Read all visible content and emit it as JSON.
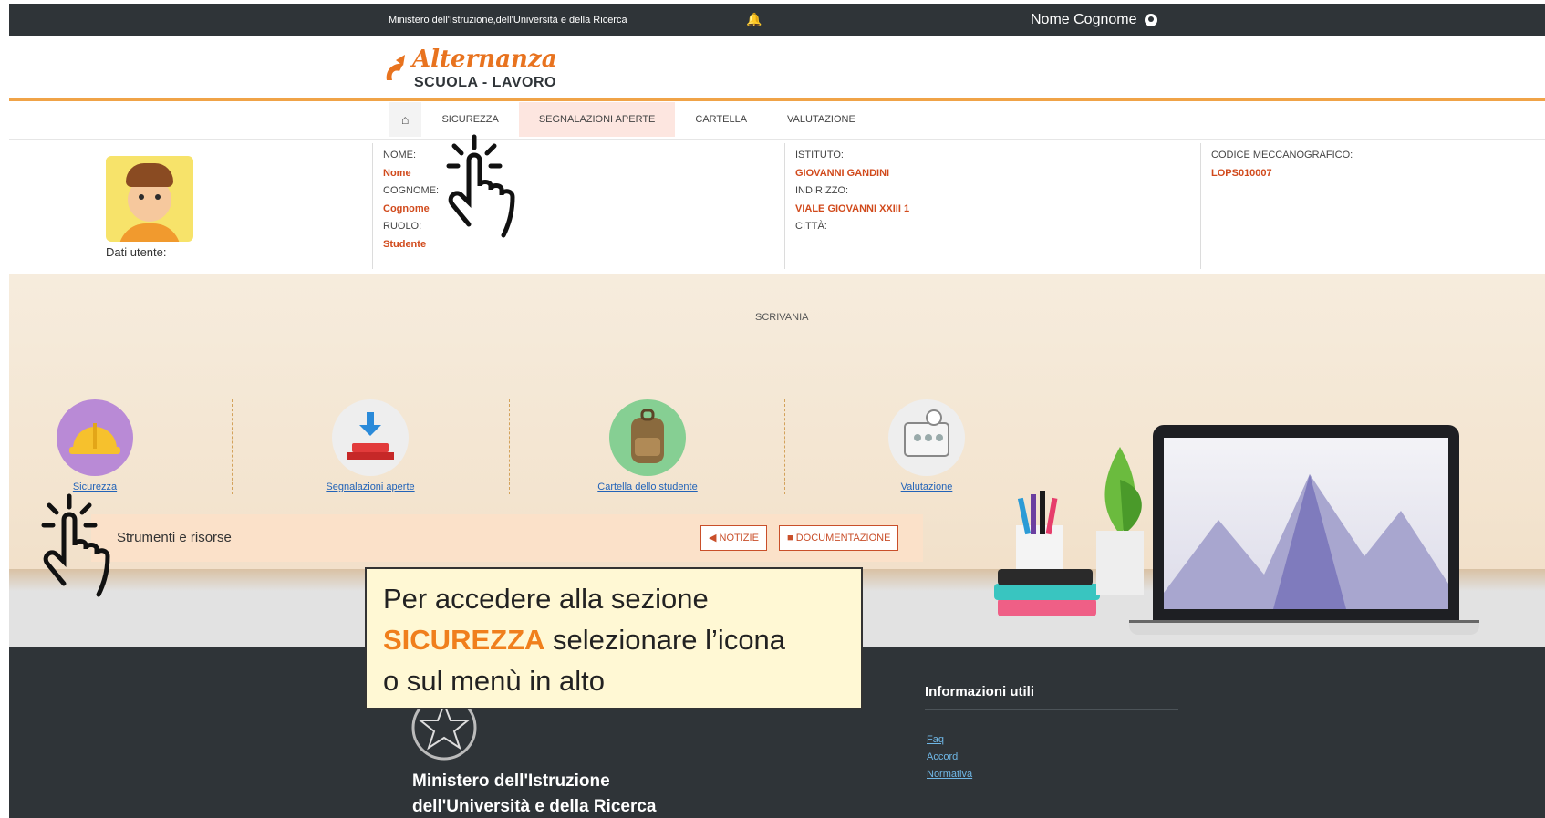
{
  "topbar": {
    "ministry": "Ministero dell'Istruzione,dell'Università e della Ricerca",
    "user_name": "Nome Cognome"
  },
  "brand": {
    "script": "Alternanza",
    "sub": "SCUOLA - LAVORO"
  },
  "nav": {
    "items": [
      "SICUREZZA",
      "SEGNALAZIONI APERTE",
      "CARTELLA",
      "VALUTAZIONE"
    ]
  },
  "userinfo": {
    "dati_label": "Dati utente:",
    "nome_label": "NOME:",
    "nome_value": "Nome",
    "cognome_label": "COGNOME:",
    "cognome_value": "Cognome",
    "ruolo_label": "RUOLO:",
    "ruolo_value": "Studente",
    "istituto_label": "ISTITUTO:",
    "istituto_value": "GIOVANNI GANDINI",
    "indirizzo_label": "INDIRIZZO:",
    "indirizzo_value": "VIALE GIOVANNI XXIII 1",
    "citta_label": "CITTÀ:",
    "codice_label": "CODICE MECCANOGRAFICO:",
    "codice_value": "LOPS010007"
  },
  "desk": {
    "title": "SCRIVANIA",
    "tiles": [
      {
        "label": "Sicurezza",
        "color": "#b98ad6"
      },
      {
        "label": "Segnalazioni aperte",
        "color": "#eeeeee"
      },
      {
        "label": "Cartella dello studente",
        "color": "#86cf93"
      },
      {
        "label": "Valutazione",
        "color": "#eeeeee"
      }
    ],
    "tools_label": "Strumenti e risorse",
    "notizie": "NOTIZIE",
    "documentazione": "DOCUMENTAZIONE"
  },
  "callout": {
    "line1": "Per accedere alla sezione",
    "highlight": "SICUREZZA",
    "line2_rest": " selezionare l’icona",
    "line3": "o sul menù in alto"
  },
  "footer": {
    "ministry_line1": "Ministero dell'Istruzione",
    "ministry_line2": "dell'Università e della Ricerca",
    "info_heading": "Informazioni utili",
    "links": [
      "Faq",
      "Accordi",
      "Normativa"
    ]
  }
}
